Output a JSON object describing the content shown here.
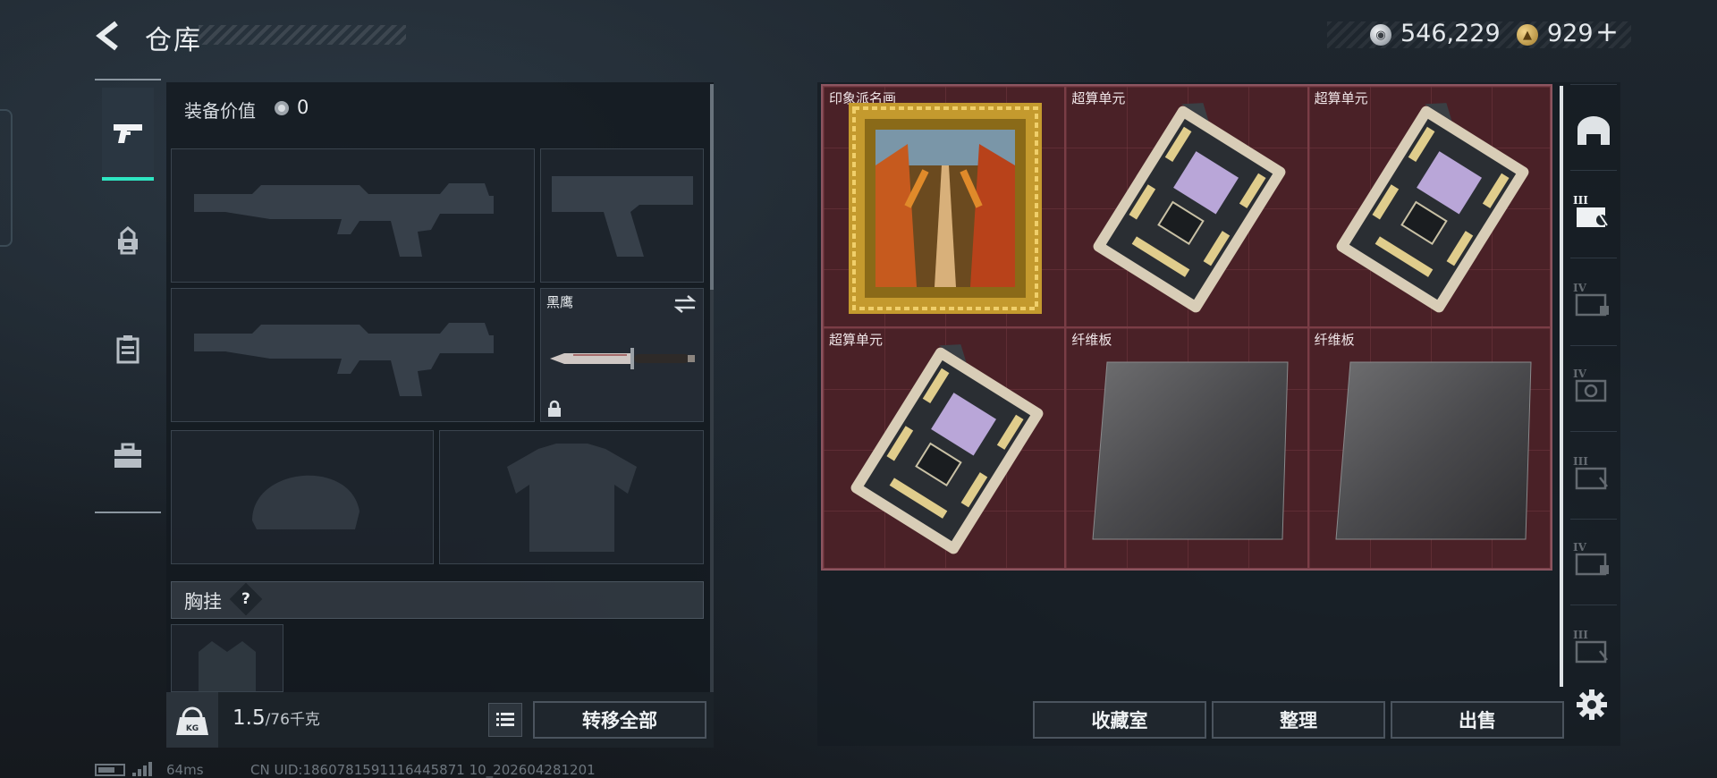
{
  "header": {
    "title": "仓库",
    "currency_silver": "546,229",
    "currency_gold": "929",
    "currency_gold_plus": "+"
  },
  "colors": {
    "accent": "#2ee6c2",
    "storage_cell": "#4a2127",
    "panel": "#141a20"
  },
  "left_tabs": [
    {
      "name": "weapon",
      "icon": "pistol-icon",
      "active": true
    },
    {
      "name": "armor",
      "icon": "backpack-icon",
      "active": false
    },
    {
      "name": "vest",
      "icon": "vest-icon",
      "active": false
    },
    {
      "name": "kit",
      "icon": "toolbox-icon",
      "active": false
    }
  ],
  "loadout": {
    "equipment_value_label": "装备价值",
    "equipment_value": "0",
    "knife_name": "黑鹰",
    "chest_rig_label": "胸挂",
    "help_mark": "?",
    "weight_current": "1.5",
    "weight_max": "/76千克",
    "transfer_all_label": "转移全部"
  },
  "storage": {
    "items": [
      {
        "name": "印象派名画",
        "kind": "painting"
      },
      {
        "name": "超算单元",
        "kind": "circuit"
      },
      {
        "name": "超算单元",
        "kind": "circuit"
      },
      {
        "name": "超算单元",
        "kind": "circuit"
      },
      {
        "name": "纤维板",
        "kind": "fiberboard"
      },
      {
        "name": "纤维板",
        "kind": "fiberboard"
      }
    ],
    "collection_label": "收藏室",
    "organize_label": "整理",
    "sell_label": "出售"
  },
  "side_tabs": [
    {
      "icon": "storage-home-icon"
    },
    {
      "icon": "container-iii-icon",
      "tier": "III"
    },
    {
      "icon": "container-iv-icon",
      "tier": "IV"
    },
    {
      "icon": "container-iv-icon",
      "tier": "IV"
    },
    {
      "icon": "container-iii-icon",
      "tier": "III"
    },
    {
      "icon": "container-iv-icon",
      "tier": "IV"
    },
    {
      "icon": "container-iii-icon",
      "tier": "III"
    }
  ],
  "footer": {
    "ping": "64ms",
    "uid": "CN UID:1860781591116445871 10_202604281201"
  }
}
